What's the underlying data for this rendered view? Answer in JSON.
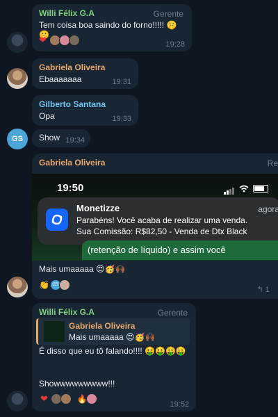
{
  "messages": {
    "m1": {
      "sender": "Willi Félix G.A",
      "role": "Gerente",
      "text": "Tem coisa boa saindo do forno!!!!! 🤫🤫",
      "time": "19:28"
    },
    "m2": {
      "sender": "Gabriela Oliveira",
      "text": "Ebaaaaaaa",
      "time": "19:31"
    },
    "m3": {
      "sender": "Gilberto Santana",
      "text": "Opa",
      "time": "19:33"
    },
    "m4": {
      "text": "Show",
      "time": "19:34",
      "avatar_initials": "GS"
    },
    "m5": {
      "sender": "Gabriela Oliveira",
      "reply_label": "Re",
      "screenshot": {
        "clock": "19:50",
        "app": "Monetizze",
        "when": "agora",
        "line1": "Parabéns! Você acaba de realizar uma venda.",
        "line2": "Sua Comissão: R$82,50 - Venda de Dtx Black",
        "green_text": "(retenção de líquido) e assim você"
      },
      "text": "Mais umaaaaa 😍🥳🙌🏾",
      "reaction_initials": "GS",
      "reply_count": "1",
      "reply_icon": "reply-arrow-icon"
    },
    "m6": {
      "sender": "Willi Félix G.A",
      "role": "Gerente",
      "quote_sender": "Gabriela Oliveira",
      "quote_text": "Mais umaaaaa 😍🥳🙌🏾",
      "text": "É disso que eu tô falando!!!! 🤑🤑🤑🤑",
      "text2": "Showwwwwwwww!!!",
      "time": "19:52"
    }
  },
  "colors": {
    "background": "#0e1621",
    "bubble": "#182533",
    "name_green": "#7fd37f",
    "name_orange": "#e8a86a",
    "name_blue": "#6ec9f0"
  }
}
